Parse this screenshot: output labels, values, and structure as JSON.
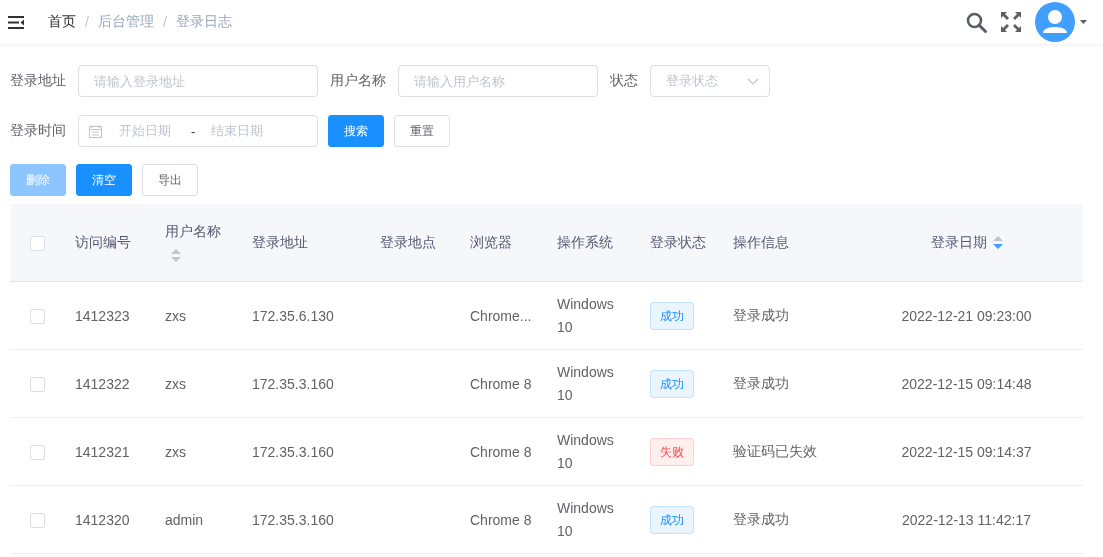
{
  "breadcrumb": [
    {
      "label": "首页",
      "current": false
    },
    {
      "label": "后台管理",
      "current": true
    },
    {
      "label": "登录日志",
      "current": true
    }
  ],
  "breadcrumb_separator": "/",
  "filters": [
    {
      "label": "登录地址",
      "kind": "input",
      "placeholder": "请输入登录地址"
    },
    {
      "label": "用户名称",
      "kind": "input",
      "placeholder": "请输入用户名称"
    },
    {
      "label": "状态",
      "kind": "select",
      "placeholder": "登录状态"
    }
  ],
  "date_filter": {
    "label": "登录时间",
    "start_placeholder": "开始日期",
    "separator": "-",
    "end_placeholder": "结束日期"
  },
  "filter_buttons": [
    {
      "label": "搜索",
      "kind": "primary",
      "disabled": false
    },
    {
      "label": "重置",
      "kind": "default",
      "disabled": false
    }
  ],
  "action_buttons": [
    {
      "label": "删除",
      "kind": "primary",
      "disabled": true
    },
    {
      "label": "清空",
      "kind": "primary",
      "disabled": false
    },
    {
      "label": "导出",
      "kind": "default",
      "disabled": false
    }
  ],
  "table": {
    "select_all_checked": false,
    "columns": [
      {
        "label": "访问编号"
      },
      {
        "label": "用户名称",
        "sortable": true,
        "sort_desc": false
      },
      {
        "label": "登录地址"
      },
      {
        "label": "登录地点"
      },
      {
        "label": "浏览器"
      },
      {
        "label": "操作系统"
      },
      {
        "label": "登录状态"
      },
      {
        "label": "操作信息"
      },
      {
        "label": "登录日期",
        "sortable": true,
        "sort_desc": true
      }
    ],
    "rows": [
      {
        "checked": false,
        "id": "1412323",
        "user": "zxs",
        "address": "172.35.6.130",
        "browser": "Chrome...",
        "os": "Windows 10",
        "status": {
          "label": "成功",
          "color": "#1890ff"
        },
        "message": "登录成功",
        "date": "2022-12-21 09:23:00"
      },
      {
        "checked": false,
        "id": "1412322",
        "user": "zxs",
        "address": "172.35.3.160",
        "browser": "Chrome 8",
        "os": "Windows 10",
        "status": {
          "label": "成功",
          "color": "#1890ff"
        },
        "message": "登录成功",
        "date": "2022-12-15 09:14:48"
      },
      {
        "checked": false,
        "id": "1412321",
        "user": "zxs",
        "address": "172.35.3.160",
        "browser": "Chrome 8",
        "os": "Windows 10",
        "status": {
          "label": "失败",
          "color": "#ff4949"
        },
        "message": "验证码已失效",
        "date": "2022-12-15 09:14:37"
      },
      {
        "checked": false,
        "id": "1412320",
        "user": "admin",
        "address": "172.35.3.160",
        "browser": "Chrome 8",
        "os": "Windows 10",
        "status": {
          "label": "成功",
          "color": "#1890ff"
        },
        "message": "登录成功",
        "date": "2022-12-13 11:42:17"
      }
    ]
  }
}
